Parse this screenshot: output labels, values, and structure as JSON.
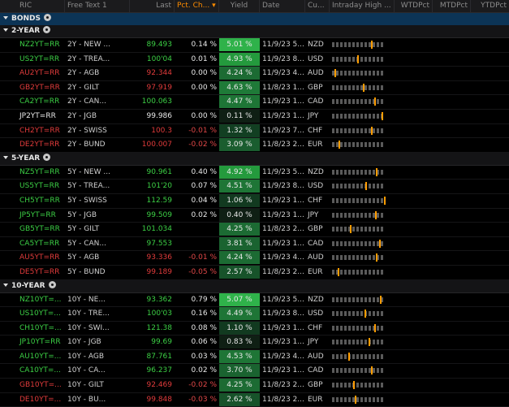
{
  "header": {
    "ric": "RIC",
    "free": "Free Text 1",
    "last": "Last",
    "pct": "Pct. Ch...",
    "yield": "Yield",
    "date": "Date",
    "cur": "Cu...",
    "bar": "Intraday High ...",
    "wtd": "WTDPct",
    "mtd": "MTDPct",
    "ytd": "YTDPct"
  },
  "bonds_label": "BONDS",
  "sections": [
    {
      "title": "2-YEAR",
      "rows": [
        {
          "ric": "NZ2YT=RR",
          "free": "2Y - NEW ...",
          "last": "89.493",
          "pct": "0.14 %",
          "yield": "5.01 %",
          "date": "11/9/23 5...",
          "cur": "NZD",
          "ric_c": "g",
          "last_c": "g",
          "y_bg": "#2fb24a",
          "pos": 0.72
        },
        {
          "ric": "US2YT=RR",
          "free": "2Y - TREA...",
          "last": "100'04",
          "pct": "0.01 %",
          "yield": "4.93 %",
          "date": "11/9/23 8...",
          "cur": "USD",
          "ric_c": "g",
          "last_c": "g",
          "y_bg": "#249a3d",
          "pos": 0.47
        },
        {
          "ric": "AU2YT=RR",
          "free": "2Y - AGB",
          "last": "92.344",
          "pct": "0.00 %",
          "yield": "4.24 %",
          "date": "11/9/23 4...",
          "cur": "AUD",
          "ric_c": "r",
          "last_c": "r",
          "y_bg": "#1c6b33",
          "pos": 0.05
        },
        {
          "ric": "GB2YT=RR",
          "free": "2Y - GILT",
          "last": "97.919",
          "pct": "0.00 %",
          "yield": "4.63 %",
          "date": "11/8/23 1...",
          "cur": "GBP",
          "ric_c": "r",
          "last_c": "r",
          "y_bg": "#1f7a38",
          "pos": 0.58
        },
        {
          "ric": "CA2YT=RR",
          "free": "2Y - CAN...",
          "last": "100.063",
          "pct": "",
          "yield": "4.47 %",
          "date": "11/9/23 1...",
          "cur": "CAD",
          "ric_c": "g",
          "last_c": "g",
          "y_bg": "#1e7536",
          "pos": 0.78
        },
        {
          "ric": "JP2YT=RR",
          "free": "2Y - JGB",
          "last": "99.986",
          "pct": "0.00 %",
          "yield": "0.11 %",
          "date": "11/9/23 1...",
          "cur": "JPY",
          "ric_c": "wt",
          "last_c": "wt",
          "y_bg": "#0f1f14",
          "pos": 0.92
        },
        {
          "ric": "CH2YT=RR",
          "free": "2Y - SWISS",
          "last": "100.3",
          "pct": "-0.01 %",
          "yield": "1.32 %",
          "date": "11/9/23 7...",
          "cur": "CHF",
          "ric_c": "r",
          "last_c": "r",
          "y_bg": "#123f22",
          "pos": 0.72
        },
        {
          "ric": "DE2YT=RR",
          "free": "2Y - BUND",
          "last": "100.007",
          "pct": "-0.02 %",
          "yield": "3.09 %",
          "date": "11/8/23 2...",
          "cur": "EUR",
          "ric_c": "r",
          "last_c": "r",
          "y_bg": "#1a5d2f",
          "pos": 0.12
        }
      ]
    },
    {
      "title": "5-YEAR",
      "rows": [
        {
          "ric": "NZ5YT=RR",
          "free": "5Y - NEW ...",
          "last": "90.961",
          "pct": "0.40 %",
          "yield": "4.92 %",
          "date": "11/9/23 5...",
          "cur": "NZD",
          "ric_c": "g",
          "last_c": "g",
          "y_bg": "#249a3d",
          "pos": 0.82
        },
        {
          "ric": "US5YT=RR",
          "free": "5Y - TREA...",
          "last": "101'20",
          "pct": "0.07 %",
          "yield": "4.51 %",
          "date": "11/9/23 8...",
          "cur": "USD",
          "ric_c": "g",
          "last_c": "g",
          "y_bg": "#1e7536",
          "pos": 0.62
        },
        {
          "ric": "CH5YT=RR",
          "free": "5Y - SWISS",
          "last": "112.59",
          "pct": "0.04 %",
          "yield": "1.06 %",
          "date": "11/9/23 1...",
          "cur": "CHF",
          "ric_c": "g",
          "last_c": "g",
          "y_bg": "#123a20",
          "pos": 0.97
        },
        {
          "ric": "JP5YT=RR",
          "free": "5Y - JGB",
          "last": "99.509",
          "pct": "0.02 %",
          "yield": "0.40 %",
          "date": "11/9/23 1...",
          "cur": "JPY",
          "ric_c": "g",
          "last_c": "g",
          "y_bg": "#0f1f14",
          "pos": 0.8
        },
        {
          "ric": "GB5YT=RR",
          "free": "5Y - GILT",
          "last": "101.034",
          "pct": "",
          "yield": "4.25 %",
          "date": "11/8/23 2...",
          "cur": "GBP",
          "ric_c": "g",
          "last_c": "g",
          "y_bg": "#1c6b33",
          "pos": 0.33
        },
        {
          "ric": "CA5YT=RR",
          "free": "5Y - CAN...",
          "last": "97.553",
          "pct": "",
          "yield": "3.81 %",
          "date": "11/9/23 1...",
          "cur": "CAD",
          "ric_c": "g",
          "last_c": "g",
          "y_bg": "#1a6330",
          "pos": 0.88
        },
        {
          "ric": "AU5YT=RR",
          "free": "5Y - AGB",
          "last": "93.336",
          "pct": "-0.01 %",
          "yield": "4.24 %",
          "date": "11/9/23 4...",
          "cur": "AUD",
          "ric_c": "r",
          "last_c": "r",
          "y_bg": "#1c6b33",
          "pos": 0.82
        },
        {
          "ric": "DE5YT=RR",
          "free": "5Y - BUND",
          "last": "99.189",
          "pct": "-0.05 %",
          "yield": "2.57 %",
          "date": "11/8/23 2...",
          "cur": "EUR",
          "ric_c": "r",
          "last_c": "r",
          "y_bg": "#17532a",
          "pos": 0.1
        }
      ]
    },
    {
      "title": "10-YEAR",
      "rows": [
        {
          "ric": "NZ10YT=...",
          "free": "10Y - NE...",
          "last": "93.362",
          "pct": "0.79 %",
          "yield": "5.07 %",
          "date": "11/9/23 5...",
          "cur": "NZD",
          "ric_c": "g",
          "last_c": "g",
          "y_bg": "#2fb24a",
          "pos": 0.9
        },
        {
          "ric": "US10YT=...",
          "free": "10Y - TRE...",
          "last": "100'03",
          "pct": "0.16 %",
          "yield": "4.49 %",
          "date": "11/9/23 8...",
          "cur": "USD",
          "ric_c": "g",
          "last_c": "g",
          "y_bg": "#1e7536",
          "pos": 0.6
        },
        {
          "ric": "CH10YT=...",
          "free": "10Y - SWI...",
          "last": "121.38",
          "pct": "0.08 %",
          "yield": "1.10 %",
          "date": "11/9/23 1...",
          "cur": "CHF",
          "ric_c": "g",
          "last_c": "g",
          "y_bg": "#123a20",
          "pos": 0.78
        },
        {
          "ric": "JP10YT=RR",
          "free": "10Y - JGB",
          "last": "99.69",
          "pct": "0.06 %",
          "yield": "0.83 %",
          "date": "11/9/23 1...",
          "cur": "JPY",
          "ric_c": "g",
          "last_c": "g",
          "y_bg": "#0f1f14",
          "pos": 0.68
        },
        {
          "ric": "AU10YT=...",
          "free": "10Y - AGB",
          "last": "87.761",
          "pct": "0.03 %",
          "yield": "4.53 %",
          "date": "11/9/23 4...",
          "cur": "AUD",
          "ric_c": "g",
          "last_c": "g",
          "y_bg": "#1e7536",
          "pos": 0.3
        },
        {
          "ric": "CA10YT=...",
          "free": "10Y - CA...",
          "last": "96.237",
          "pct": "0.02 %",
          "yield": "3.70 %",
          "date": "11/9/23 1...",
          "cur": "CAD",
          "ric_c": "g",
          "last_c": "g",
          "y_bg": "#1a6330",
          "pos": 0.72
        },
        {
          "ric": "GB10YT=...",
          "free": "10Y - GILT",
          "last": "92.469",
          "pct": "-0.02 %",
          "yield": "4.25 %",
          "date": "11/8/23 2...",
          "cur": "GBP",
          "ric_c": "r",
          "last_c": "r",
          "y_bg": "#1c6b33",
          "pos": 0.4
        },
        {
          "ric": "DE10YT=...",
          "free": "10Y - BU...",
          "last": "99.848",
          "pct": "-0.03 %",
          "yield": "2.62 %",
          "date": "11/8/23 2...",
          "cur": "EUR",
          "ric_c": "r",
          "last_c": "r",
          "y_bg": "#17532a",
          "pos": 0.42
        }
      ]
    }
  ]
}
